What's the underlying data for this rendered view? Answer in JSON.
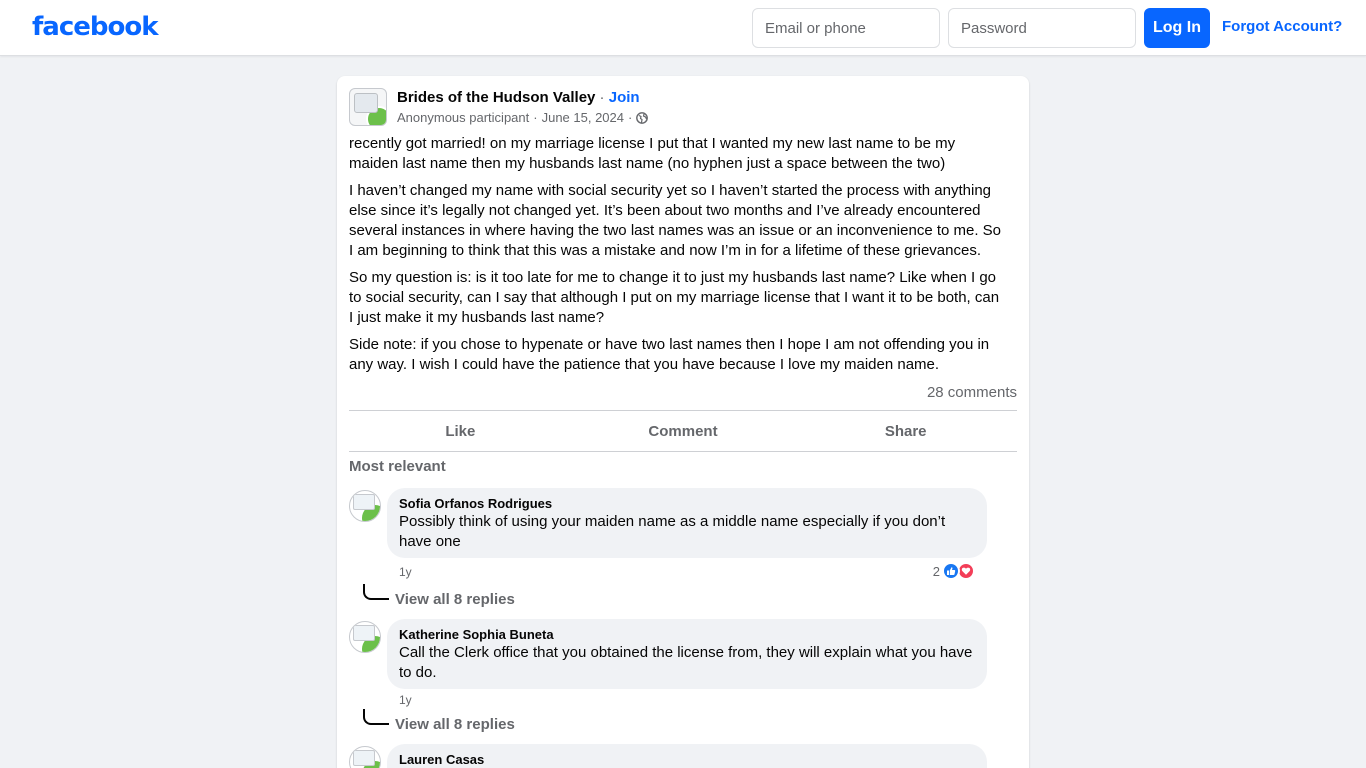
{
  "header": {
    "logo": "facebook",
    "email_placeholder": "Email or phone",
    "password_placeholder": "Password",
    "login_label": "Log In",
    "forgot_label": "Forgot Account?"
  },
  "post": {
    "group_name": "Brides of the Hudson Valley",
    "separator": " · ",
    "join_label": "Join",
    "author": "Anonymous participant",
    "date": "June 15, 2024",
    "meta_sep": "·",
    "paragraphs": [
      "recently got married! on my marriage license I put that I wanted my new last name to be my maiden last name then my husbands last name (no hyphen just a space between the two)",
      "I haven’t changed my name with social security yet so I haven’t started the process with anything else since it’s legally not changed yet. It’s been about two months and I’ve already encountered several instances in where having the two last names was an issue or an inconvenience to me. So I am beginning to think that this was a mistake and now I’m in for a lifetime of these grievances.",
      "So my question is: is it too late for me to change it to just my husbands last name? Like when I go to social security, can I say that although I put on my marriage license that I want it to be both, can I just make it my husbands last name?",
      "Side note: if you chose to hypenate or have two last names then I hope I am not offending you in any way. I wish I could have the patience that you have because I love my maiden name."
    ],
    "comment_count": "28 comments",
    "actions": {
      "like": "Like",
      "comment": "Comment",
      "share": "Share"
    },
    "sort_label": "Most relevant"
  },
  "comments": [
    {
      "author": "Sofia Orfanos Rodrigues",
      "text": "Possibly think of using your maiden name as a middle name especially if you don’t have one",
      "time": "1y",
      "reaction_count": "2",
      "replies_label": "View all 8 replies"
    },
    {
      "author": "Katherine Sophia Buneta",
      "text": "Call the Clerk office that you obtained the license from, they will explain what you have to do.",
      "time": "1y",
      "replies_label": "View all 8 replies"
    },
    {
      "author": "Lauren Casas"
    }
  ],
  "colors": {
    "brand": "#0866ff",
    "background": "#f0f2f5",
    "like_reaction": "#1877f2",
    "love_reaction": "#f33e58"
  },
  "icons": {
    "audience": "globe-icon",
    "reaction_like": "thumbs-up-icon",
    "reaction_love": "heart-icon"
  }
}
